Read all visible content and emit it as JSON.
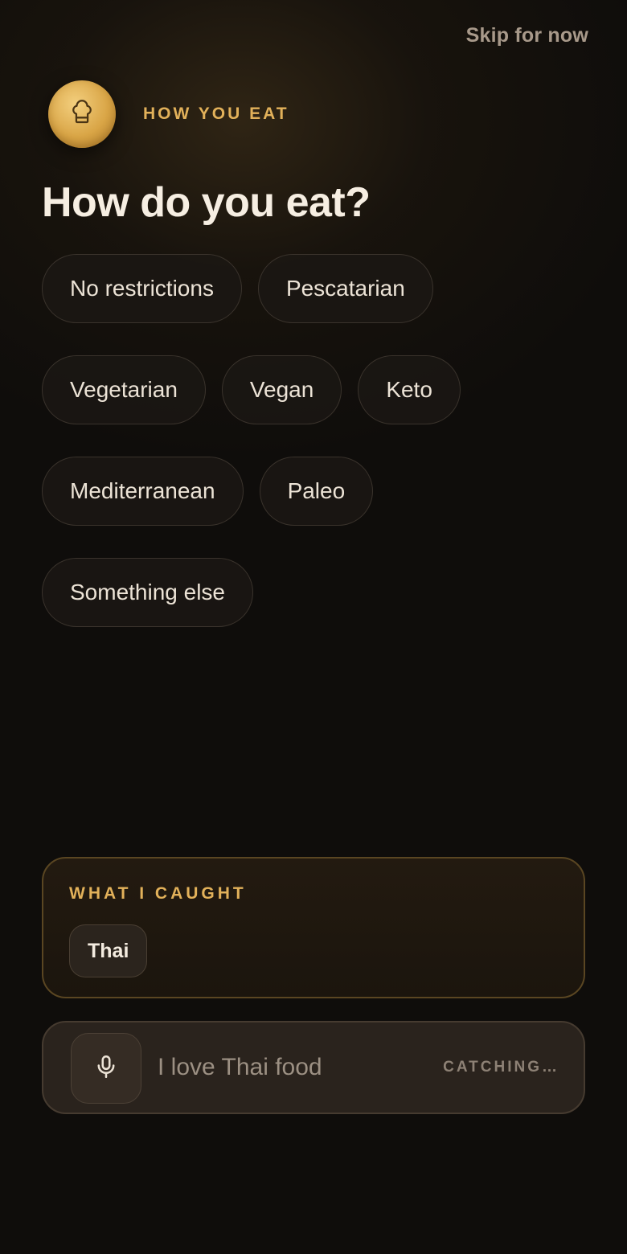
{
  "skip_label": "Skip for now",
  "header": {
    "avatar_icon": "chef-hat-icon",
    "eyebrow": "HOW YOU EAT"
  },
  "title": "How do you eat?",
  "options": [
    "No restrictions",
    "Pescatarian",
    "Vegetarian",
    "Vegan",
    "Keto",
    "Mediterranean",
    "Paleo",
    "Something else"
  ],
  "caught": {
    "label": "WHAT I CAUGHT",
    "items": [
      "Thai"
    ]
  },
  "input": {
    "mic_icon": "microphone-icon",
    "value": "I love Thai food",
    "status": "CATCHING…"
  },
  "colors": {
    "accent_gold": "#e2b15a",
    "background": "#0f0d0b",
    "chip_border": "#3a332c"
  }
}
